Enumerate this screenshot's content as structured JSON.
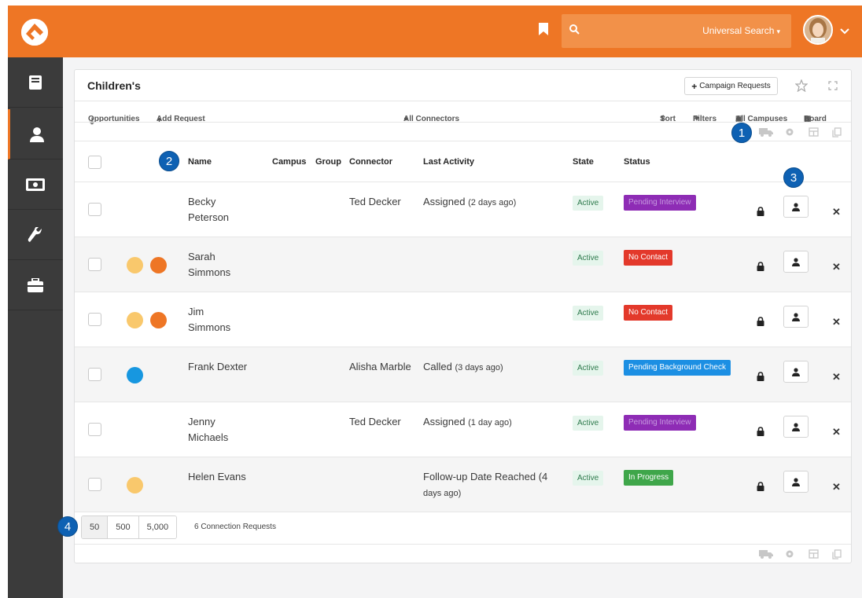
{
  "topbar": {
    "search_scope": "Universal Search",
    "icons": [
      "rock-logo-icon",
      "bookmark-icon",
      "search-icon",
      "avatar",
      "chevron-down-icon"
    ]
  },
  "sidebar": {
    "items": [
      {
        "icon": "book-icon"
      },
      {
        "icon": "person-icon",
        "active": true
      },
      {
        "icon": "money-icon"
      },
      {
        "icon": "wrench-icon"
      },
      {
        "icon": "briefcase-icon"
      }
    ]
  },
  "panel": {
    "title": "Children's",
    "campaign_button": "Campaign Requests",
    "toolbar": {
      "opportunities": "Opportunities",
      "add_request": "Add Request",
      "all_connectors": "All Connectors",
      "sort": "Sort",
      "filters": "Filters",
      "all_campuses": "All Campuses",
      "board": "Board"
    }
  },
  "table": {
    "headers": {
      "name": "Name",
      "campus": "Campus",
      "group": "Group",
      "connector": "Connector",
      "last_activity": "Last Activity",
      "state": "State",
      "status": "Status"
    },
    "rows": [
      {
        "first": "Becky",
        "last": "Peterson",
        "connector": "Ted Decker",
        "activity": "Assigned",
        "activity_ago": "(2 days ago)",
        "state": "Active",
        "status": "Pending Interview",
        "status_color": "#8e2cb5",
        "dots": []
      },
      {
        "first": "Sarah",
        "last": "Simmons",
        "connector": "",
        "activity": "",
        "activity_ago": "",
        "state": "Active",
        "status": "No Contact",
        "status_color": "#e3392b",
        "dots": [
          "#f9c86c",
          "#ee7625"
        ]
      },
      {
        "first": "Jim",
        "last": "Simmons",
        "connector": "",
        "activity": "",
        "activity_ago": "",
        "state": "Active",
        "status": "No Contact",
        "status_color": "#e3392b",
        "dots": [
          "#f9c86c",
          "#ee7625"
        ]
      },
      {
        "first": "Frank Dexter",
        "last": "",
        "connector": "Alisha Marble",
        "activity": "Called",
        "activity_ago": "(3 days ago)",
        "state": "Active",
        "status": "Pending Background Check",
        "status_color": "#1c8fe3",
        "dots": [
          "#1797e0"
        ]
      },
      {
        "first": "Jenny",
        "last": "Michaels",
        "connector": "Ted Decker",
        "activity": "Assigned",
        "activity_ago": "(1 day ago)",
        "state": "Active",
        "status": "Pending Interview",
        "status_color": "#8e2cb5",
        "dots": []
      },
      {
        "first": "Helen Evans",
        "last": "",
        "connector": "",
        "activity": "Follow-up Date Reached (4",
        "activity_ago": "days ago)",
        "state": "Active",
        "status": "In Progress",
        "status_color": "#3fa64a",
        "dots": [
          "#f9c86c"
        ]
      }
    ]
  },
  "footer": {
    "page_sizes": [
      "50",
      "500",
      "5,000"
    ],
    "selected_page_size": "50",
    "count_text": "6 Connection Requests"
  },
  "callouts": [
    "1",
    "2",
    "3",
    "4"
  ],
  "colors": {
    "brand": "#ee7625",
    "sidebar": "#3b3b3b",
    "callout": "#0e61b3"
  }
}
